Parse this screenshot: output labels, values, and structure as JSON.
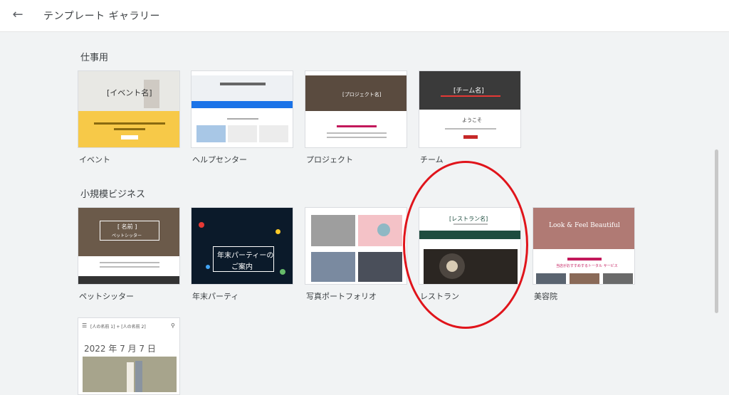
{
  "header": {
    "title": "テンプレート ギャラリー"
  },
  "sections": [
    {
      "label": "仕事用"
    },
    {
      "label": "小規模ビジネス"
    }
  ],
  "templates": [
    {
      "label": "イベント",
      "preview_text": "[イベント名]"
    },
    {
      "label": "ヘルプセンター"
    },
    {
      "label": "プロジェクト",
      "preview_text": "[プロジェクト名]"
    },
    {
      "label": "チーム",
      "preview_text": "[チーム名]",
      "preview_text2": "ようこそ"
    },
    {
      "label": "ペットシッター",
      "preview_text": "[ 名前 ]",
      "preview_text2": "ペットシッター"
    },
    {
      "label": "年末パーティ",
      "preview_text": "年末パーティーの",
      "preview_text2": "ご案内"
    },
    {
      "label": "写真ポートフォリオ"
    },
    {
      "label": "レストラン",
      "preview_text": "[レストラン名]"
    },
    {
      "label": "美容院",
      "preview_text": "Look & Feel Beautiful",
      "preview_text2": "当店がおすすめするトータル サービス"
    },
    {
      "label": "",
      "preview_text": "[人の名前 1] + [人の名前 2]",
      "preview_text2": "2022 年 7 月 7 日"
    }
  ],
  "colors": {
    "highlight_circle": "#e0141b",
    "event_yellow": "#f7c948",
    "team_dark": "#3a3a3a",
    "restaurant_green": "#1e4d3f"
  }
}
